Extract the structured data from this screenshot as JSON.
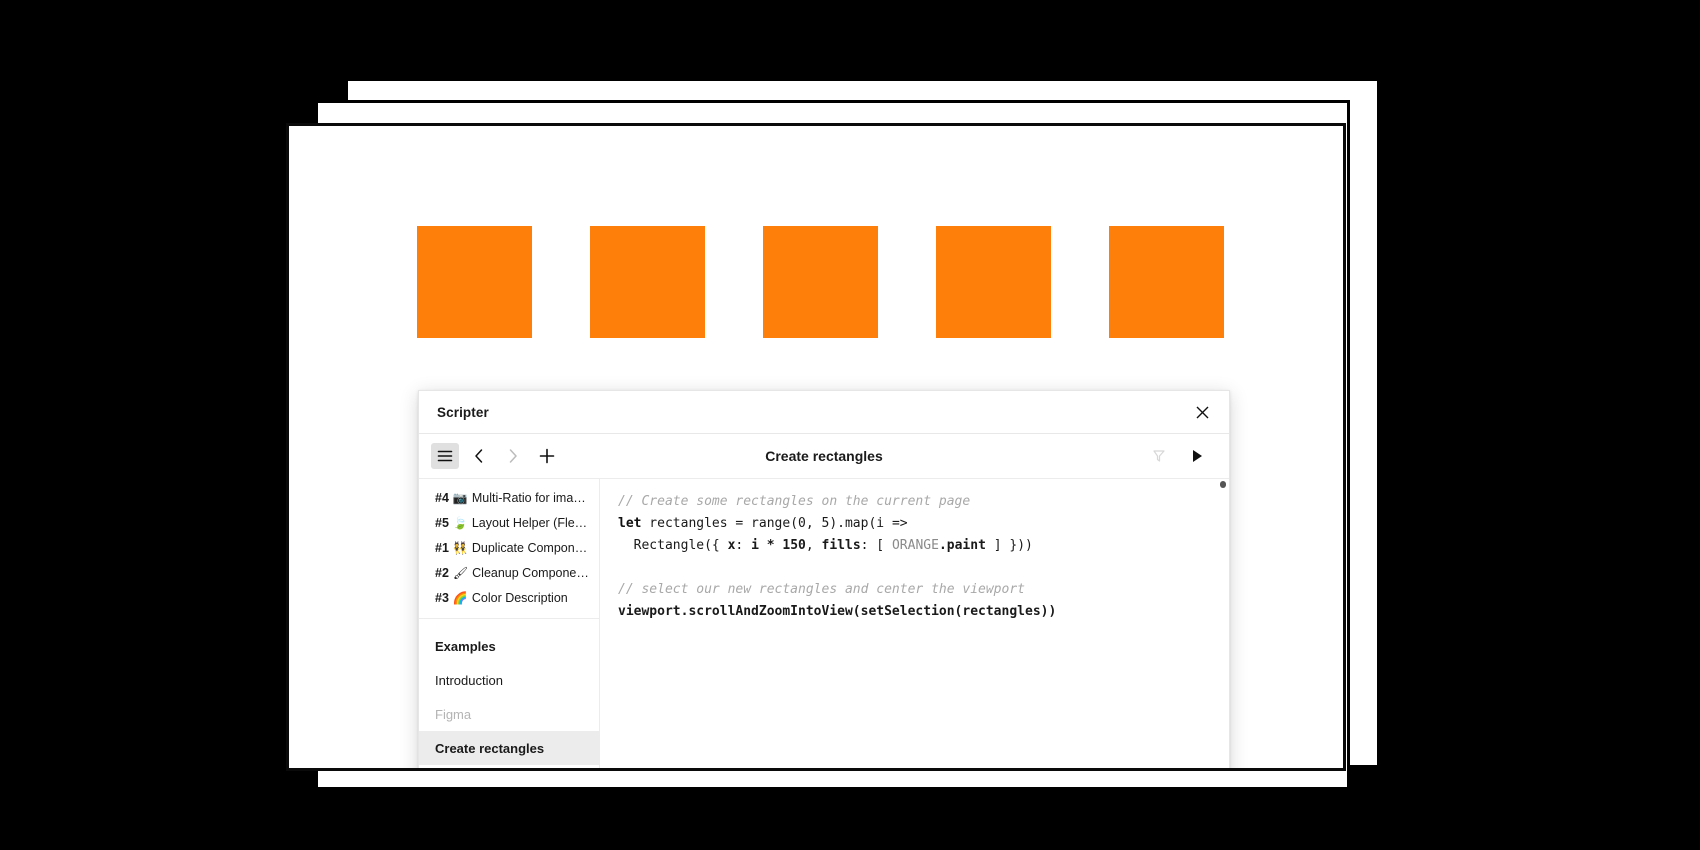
{
  "canvas": {
    "rect_color": "#FF7F0B",
    "rect_count": 5,
    "rect_label": "rectangle"
  },
  "plugin": {
    "window_title": "Scripter",
    "close_icon": "close-icon",
    "toolbar": {
      "menu_icon": "hamburger-menu-icon",
      "back_icon": "chevron-left-icon",
      "forward_icon": "chevron-right-icon",
      "new_icon": "plus-icon",
      "clear_icon": "clear-icon",
      "run_icon": "play-icon",
      "script_title": "Create rectangles"
    },
    "sidebar": {
      "scripts": [
        {
          "num": "#4",
          "emoji": "📷",
          "name": "Multi-Ratio for ima…"
        },
        {
          "num": "#5",
          "emoji": "🍃",
          "name": "Layout Helper (Fle…"
        },
        {
          "num": "#1",
          "emoji": "👯",
          "name": "Duplicate Compon…"
        },
        {
          "num": "#2",
          "emoji": "🖌",
          "name": "Cleanup Compone…"
        },
        {
          "num": "#3",
          "emoji": "🌈",
          "name": "Color Description"
        }
      ],
      "nav": [
        {
          "label": "Examples",
          "style": "head"
        },
        {
          "label": "Introduction",
          "style": "normal"
        },
        {
          "label": "Figma",
          "style": "muted"
        },
        {
          "label": "Create rectangles",
          "style": "selected"
        }
      ]
    },
    "editor": {
      "lines": [
        [
          {
            "t": "comment",
            "s": "// Create some rectangles on the current page"
          }
        ],
        [
          {
            "t": "kw",
            "s": "let"
          },
          {
            "t": "plain",
            "s": " rectangles = range(0, 5).map(i =>"
          }
        ],
        [
          {
            "t": "plain",
            "s": "  Rectangle({ "
          },
          {
            "t": "bold",
            "s": "x"
          },
          {
            "t": "plain",
            "s": ": "
          },
          {
            "t": "bold",
            "s": "i * 150"
          },
          {
            "t": "plain",
            "s": ", "
          },
          {
            "t": "bold",
            "s": "fills"
          },
          {
            "t": "plain",
            "s": ": [ "
          },
          {
            "t": "dim",
            "s": "ORANGE"
          },
          {
            "t": "bold",
            "s": ".paint"
          },
          {
            "t": "plain",
            "s": " ] }))"
          }
        ],
        [
          {
            "t": "plain",
            "s": ""
          }
        ],
        [
          {
            "t": "comment",
            "s": "// select our new rectangles and center the viewport"
          }
        ],
        [
          {
            "t": "bold",
            "s": "viewport.scrollAndZoomIntoView(setSelection(rectangles))"
          }
        ]
      ]
    }
  }
}
